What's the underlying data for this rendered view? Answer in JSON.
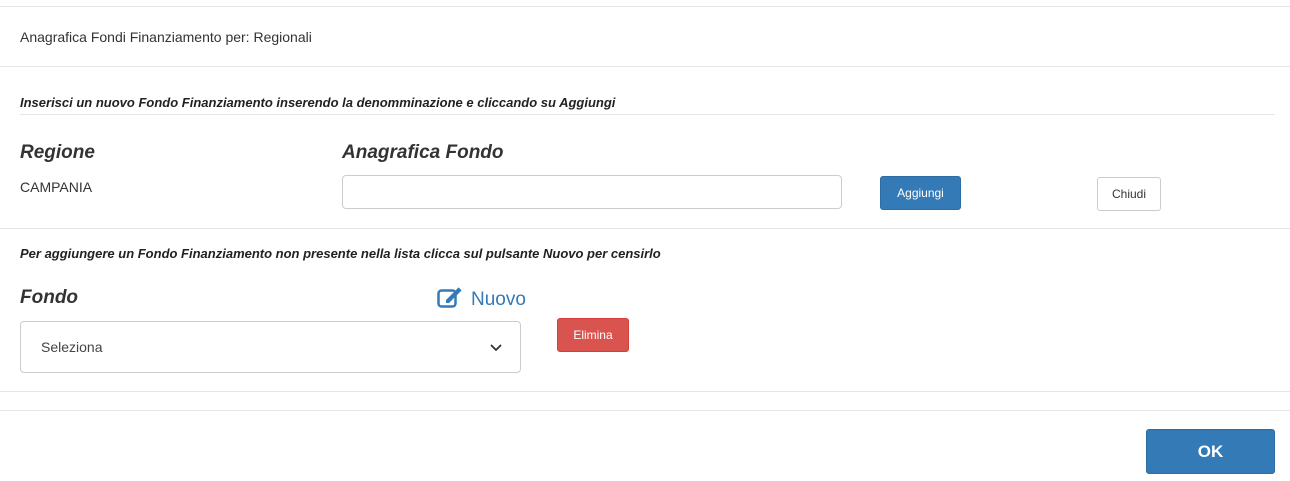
{
  "modal": {
    "title": "Anagrafica Fondi Finanziamento per: Regionali"
  },
  "add_section": {
    "instruction": "Inserisci un nuovo Fondo Finanziamento inserendo la denomminazione e cliccando su Aggiungi",
    "regione_label": "Regione",
    "regione_value": "CAMPANIA",
    "anagrafica_label": "Anagrafica Fondo",
    "anagrafica_input_value": "",
    "aggiungi_label": "Aggiungi",
    "chiudi_label": "Chiudi"
  },
  "select_section": {
    "instruction": "Per aggiungere un Fondo Finanziamento non presente nella lista clicca sul pulsante Nuovo per censirlo",
    "fondo_label": "Fondo",
    "nuovo_label": "Nuovo",
    "select_value": "Seleziona",
    "elimina_label": "Elimina"
  },
  "footer": {
    "ok_label": "OK"
  },
  "colors": {
    "primary": "#337ab7",
    "danger": "#d9534f",
    "border": "#cccccc",
    "divider": "#e5e5e5"
  },
  "icons": {
    "nuovo": "edit-icon",
    "select": "chevron-down-icon"
  }
}
